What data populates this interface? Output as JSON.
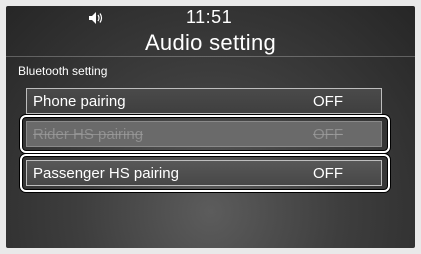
{
  "status": {
    "volume_icon": "speaker-volume-icon",
    "time": "11:51"
  },
  "header": {
    "title": "Audio setting"
  },
  "section": {
    "label": "Bluetooth setting"
  },
  "settings": [
    {
      "label": "Phone pairing",
      "value": "OFF",
      "enabled": true
    },
    {
      "label": "Rider HS pairing",
      "value": "OFF",
      "enabled": false
    },
    {
      "label": "Passenger HS pairing",
      "value": "OFF",
      "enabled": true
    }
  ],
  "colors": {
    "text": "#ffffff",
    "disabled_text": "#8f8f8f",
    "callout": "#ffffff"
  }
}
